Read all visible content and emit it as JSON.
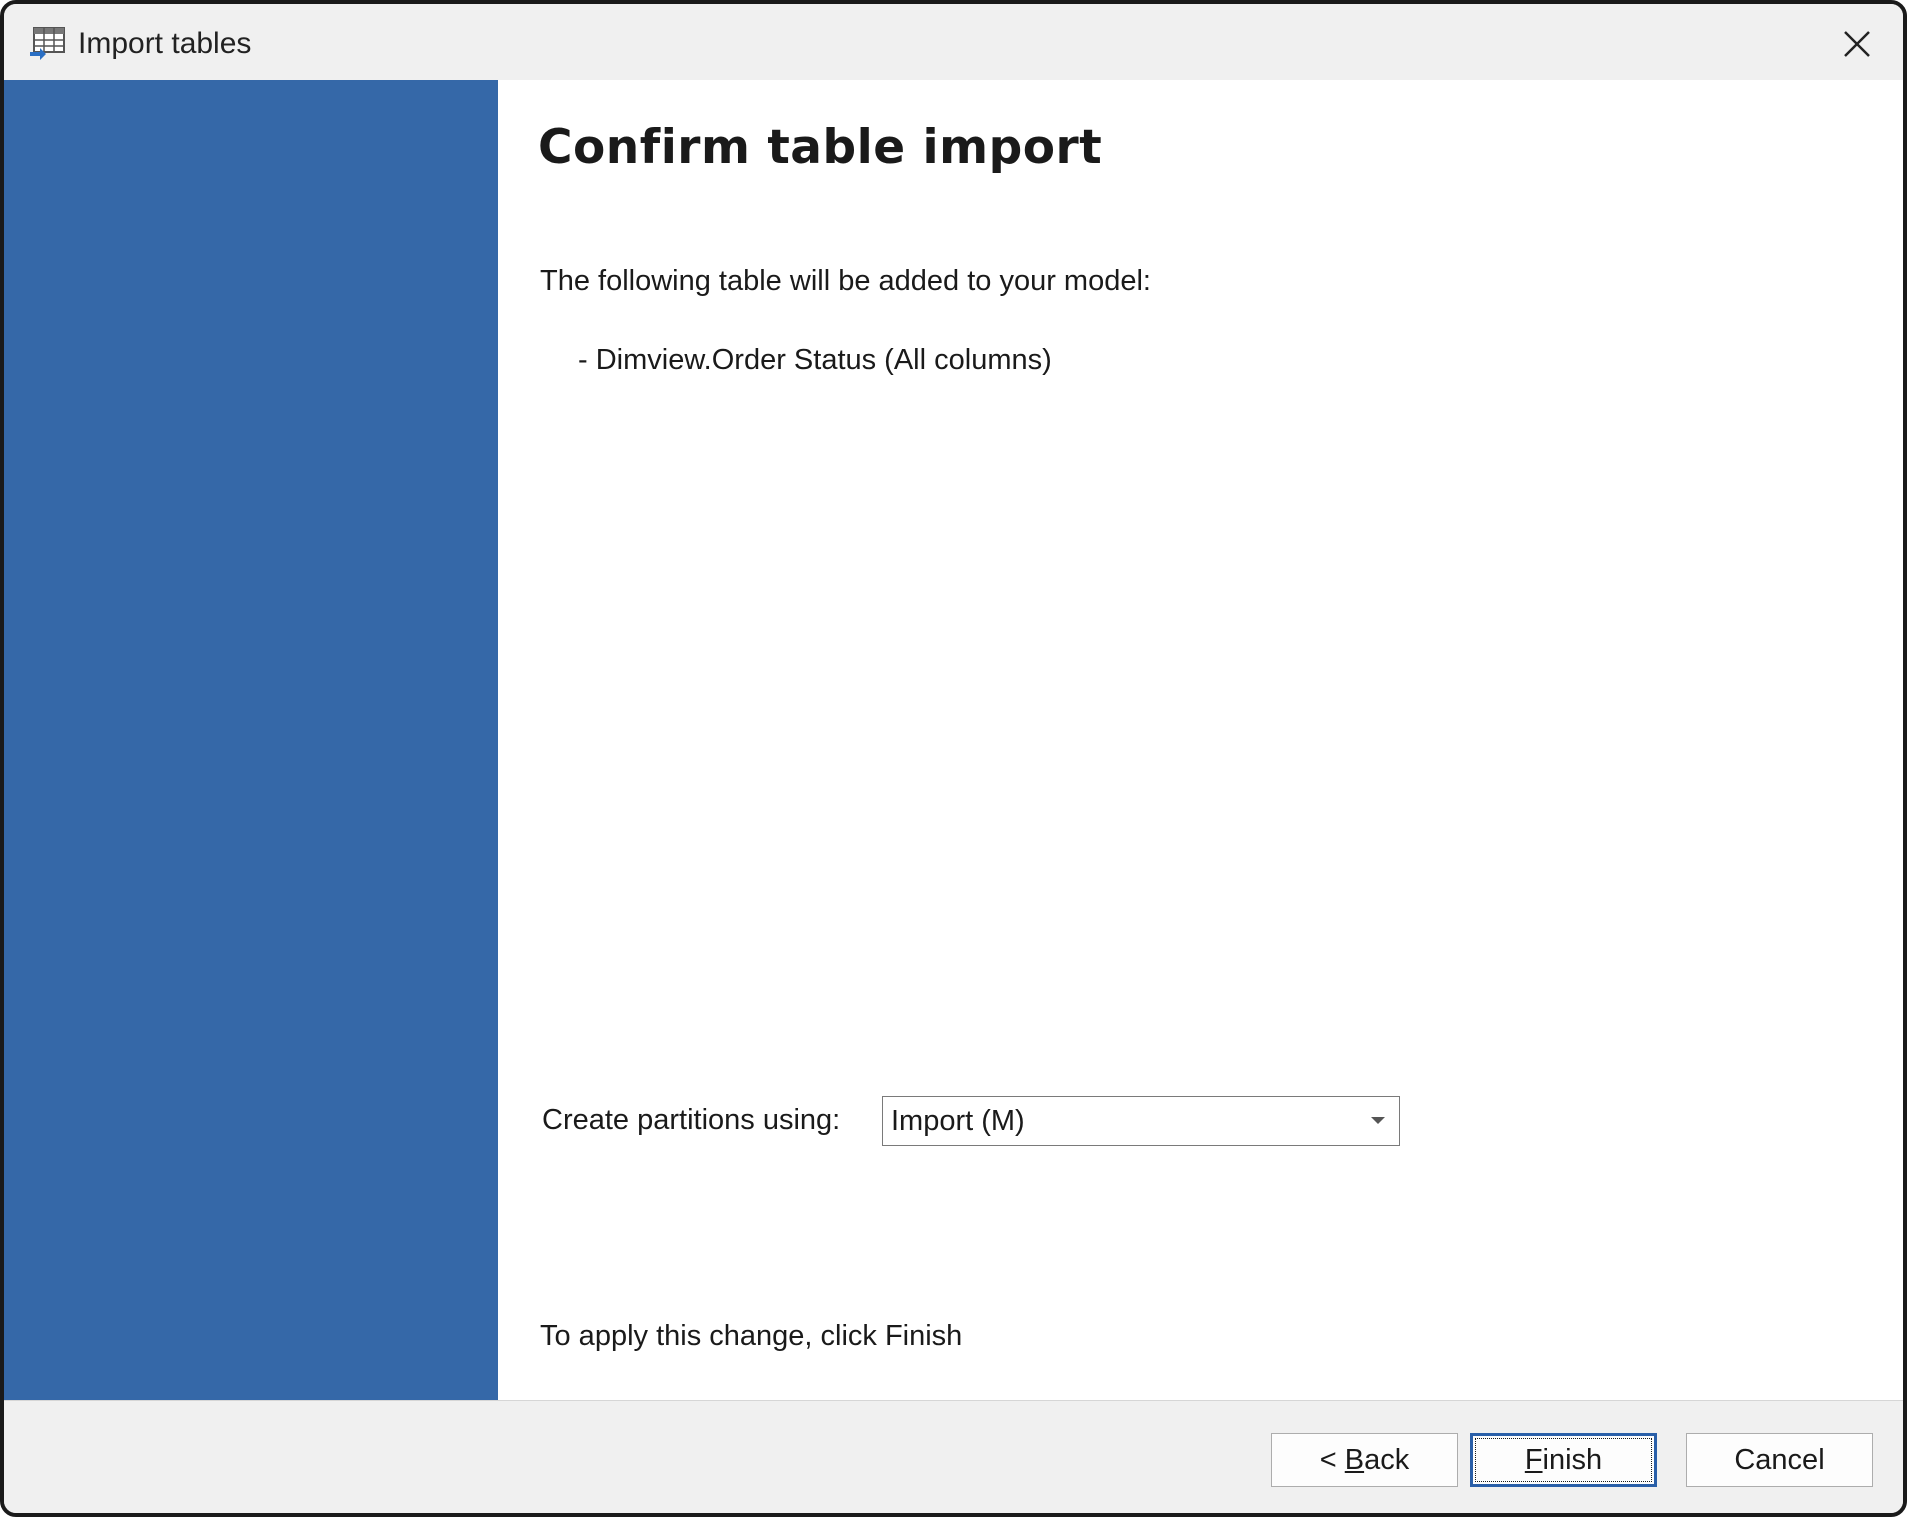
{
  "window": {
    "title": "Import tables",
    "app_icon": "import-table-icon",
    "close_icon": "close-icon"
  },
  "colors": {
    "sidebar": "#3568a8",
    "titlebar": "#f0f0f0",
    "content_bg": "#ffffff",
    "focus_border": "#2a5fa8"
  },
  "main": {
    "heading": "Confirm table import",
    "intro": "The following table will be added to your model:",
    "tables": [
      "- Dimview.Order Status (All columns)"
    ],
    "partition_label": "Create partitions using:",
    "partition_value": "Import (M)",
    "apply_note": "To apply this change, click Finish"
  },
  "footer": {
    "back_prefix": "< ",
    "back_mnemonic": "B",
    "back_rest": "ack",
    "finish_mnemonic": "F",
    "finish_rest": "inish",
    "cancel_label": "Cancel"
  }
}
